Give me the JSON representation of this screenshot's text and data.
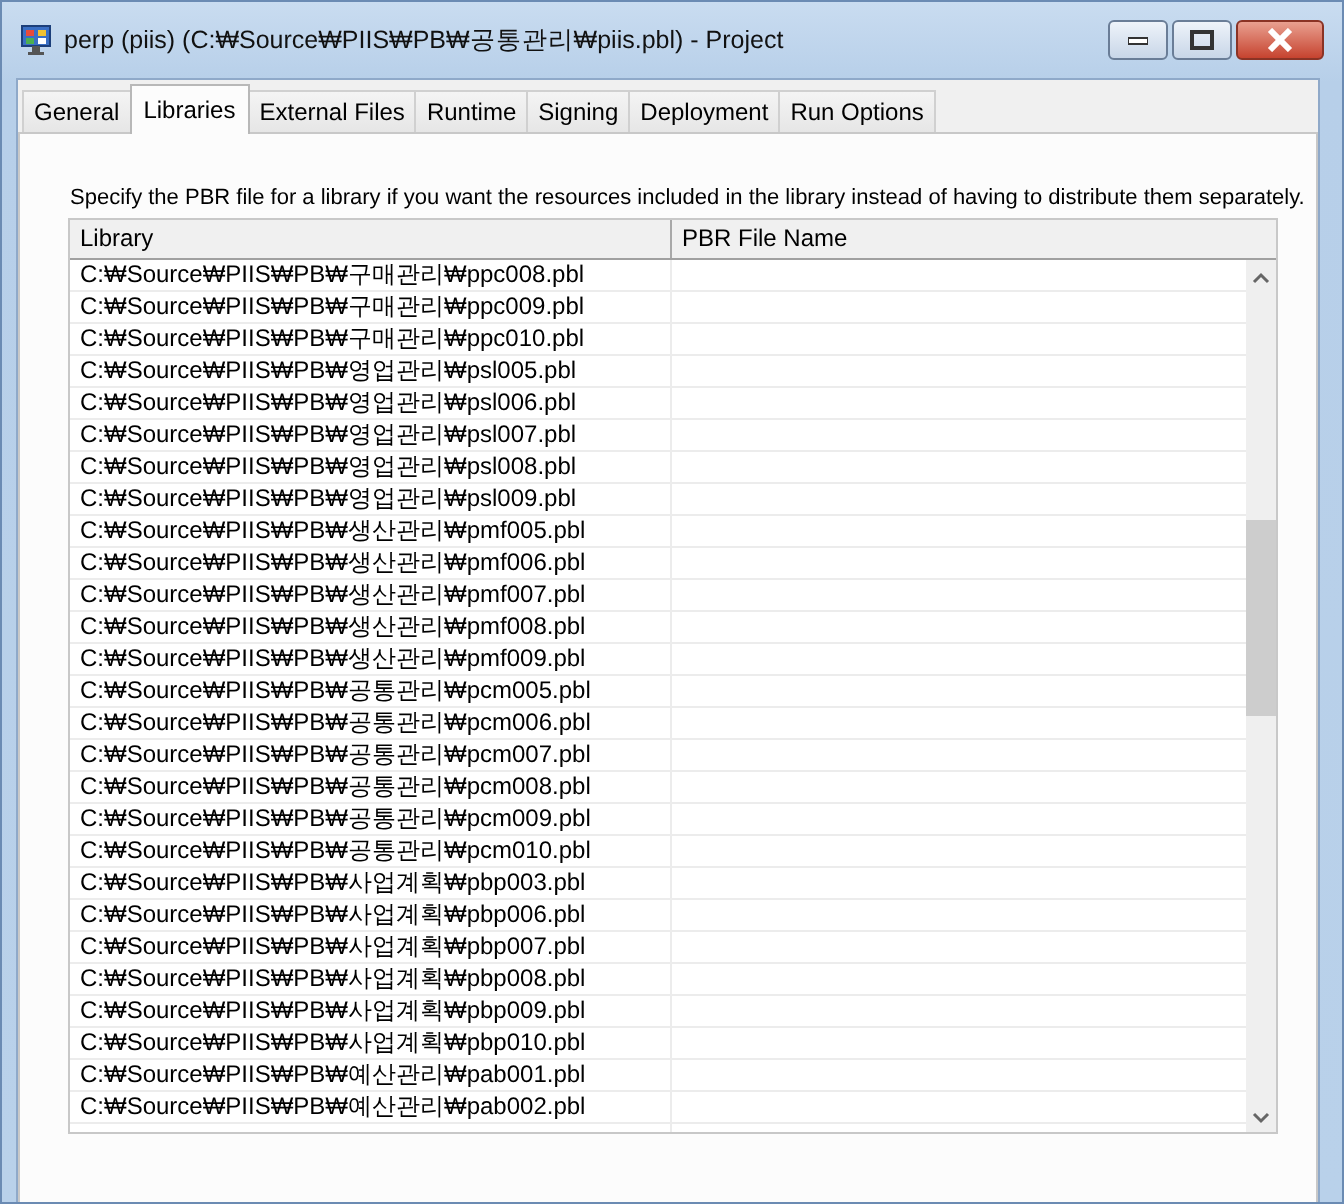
{
  "window": {
    "title": "perp (piis) (C:₩Source₩PIIS₩PB₩공통관리₩piis.pbl) - Project"
  },
  "tabs": [
    {
      "label": "General",
      "selected": false
    },
    {
      "label": "Libraries",
      "selected": true
    },
    {
      "label": "External Files",
      "selected": false
    },
    {
      "label": "Runtime",
      "selected": false
    },
    {
      "label": "Signing",
      "selected": false
    },
    {
      "label": "Deployment",
      "selected": false
    },
    {
      "label": "Run Options",
      "selected": false
    }
  ],
  "description": "Specify the PBR file for a library if you want the resources included in the library instead of having to distribute them separately.",
  "table": {
    "columns": [
      "Library",
      "PBR File Name"
    ],
    "rows": [
      {
        "library": "C:₩Source₩PIIS₩PB₩구매관리₩ppc008.pbl"
      },
      {
        "library": "C:₩Source₩PIIS₩PB₩구매관리₩ppc009.pbl"
      },
      {
        "library": "C:₩Source₩PIIS₩PB₩구매관리₩ppc010.pbl"
      },
      {
        "library": "C:₩Source₩PIIS₩PB₩영업관리₩psl005.pbl"
      },
      {
        "library": "C:₩Source₩PIIS₩PB₩영업관리₩psl006.pbl"
      },
      {
        "library": "C:₩Source₩PIIS₩PB₩영업관리₩psl007.pbl"
      },
      {
        "library": "C:₩Source₩PIIS₩PB₩영업관리₩psl008.pbl"
      },
      {
        "library": "C:₩Source₩PIIS₩PB₩영업관리₩psl009.pbl"
      },
      {
        "library": "C:₩Source₩PIIS₩PB₩생산관리₩pmf005.pbl"
      },
      {
        "library": "C:₩Source₩PIIS₩PB₩생산관리₩pmf006.pbl"
      },
      {
        "library": "C:₩Source₩PIIS₩PB₩생산관리₩pmf007.pbl"
      },
      {
        "library": "C:₩Source₩PIIS₩PB₩생산관리₩pmf008.pbl"
      },
      {
        "library": "C:₩Source₩PIIS₩PB₩생산관리₩pmf009.pbl"
      },
      {
        "library": "C:₩Source₩PIIS₩PB₩공통관리₩pcm005.pbl"
      },
      {
        "library": "C:₩Source₩PIIS₩PB₩공통관리₩pcm006.pbl"
      },
      {
        "library": "C:₩Source₩PIIS₩PB₩공통관리₩pcm007.pbl"
      },
      {
        "library": "C:₩Source₩PIIS₩PB₩공통관리₩pcm008.pbl"
      },
      {
        "library": "C:₩Source₩PIIS₩PB₩공통관리₩pcm009.pbl"
      },
      {
        "library": "C:₩Source₩PIIS₩PB₩공통관리₩pcm010.pbl"
      },
      {
        "library": "C:₩Source₩PIIS₩PB₩사업계획₩pbp003.pbl"
      },
      {
        "library": "C:₩Source₩PIIS₩PB₩사업계획₩pbp006.pbl"
      },
      {
        "library": "C:₩Source₩PIIS₩PB₩사업계획₩pbp007.pbl"
      },
      {
        "library": "C:₩Source₩PIIS₩PB₩사업계획₩pbp008.pbl"
      },
      {
        "library": "C:₩Source₩PIIS₩PB₩사업계획₩pbp009.pbl"
      },
      {
        "library": "C:₩Source₩PIIS₩PB₩사업계획₩pbp010.pbl"
      },
      {
        "library": "C:₩Source₩PIIS₩PB₩예산관리₩pab001.pbl"
      },
      {
        "library": "C:₩Source₩PIIS₩PB₩예산관리₩pab002.pbl"
      }
    ]
  }
}
